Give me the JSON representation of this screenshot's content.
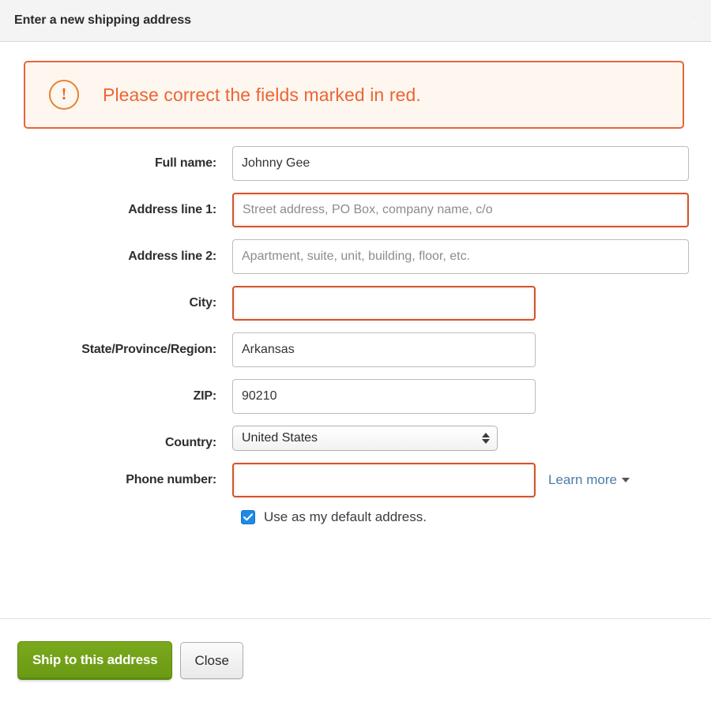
{
  "header": {
    "title": "Enter a new shipping address",
    "close_glyph": "×"
  },
  "alert": {
    "icon_glyph": "!",
    "message": "Please correct the fields marked in red.",
    "border_color": "#e4663a",
    "text_color": "#ed6433",
    "background_color": "#fdf7f0"
  },
  "form": {
    "fields": [
      {
        "label": "Full name:",
        "value": "Johnny Gee",
        "placeholder": "",
        "error": false,
        "width": "wide"
      },
      {
        "label": "Address line 1:",
        "value": "",
        "placeholder": "Street address, PO Box, company name, c/o",
        "error": true,
        "width": "wide"
      },
      {
        "label": "Address line 2:",
        "value": "",
        "placeholder": "Apartment, suite, unit, building, floor, etc.",
        "error": false,
        "width": "wide"
      },
      {
        "label": "City:",
        "value": "",
        "placeholder": "",
        "error": true,
        "width": "mid"
      },
      {
        "label": "State/Province/Region:",
        "value": "Arkansas",
        "placeholder": "",
        "error": false,
        "width": "mid"
      },
      {
        "label": "ZIP:",
        "value": "90210",
        "placeholder": "",
        "error": false,
        "width": "mid"
      }
    ],
    "country": {
      "label": "Country:",
      "selected": "United States"
    },
    "phone": {
      "label": "Phone number:",
      "value": "",
      "placeholder": "",
      "error": true,
      "learn_more_label": "Learn more",
      "learn_more_color": "#4b7ca8"
    },
    "default_address": {
      "label": "Use as my default address.",
      "checked": true,
      "checkbox_color": "#1e8ae8"
    }
  },
  "footer": {
    "submit_label": "Ship to this address",
    "submit_color": "#6b9a14",
    "close_label": "Close"
  }
}
